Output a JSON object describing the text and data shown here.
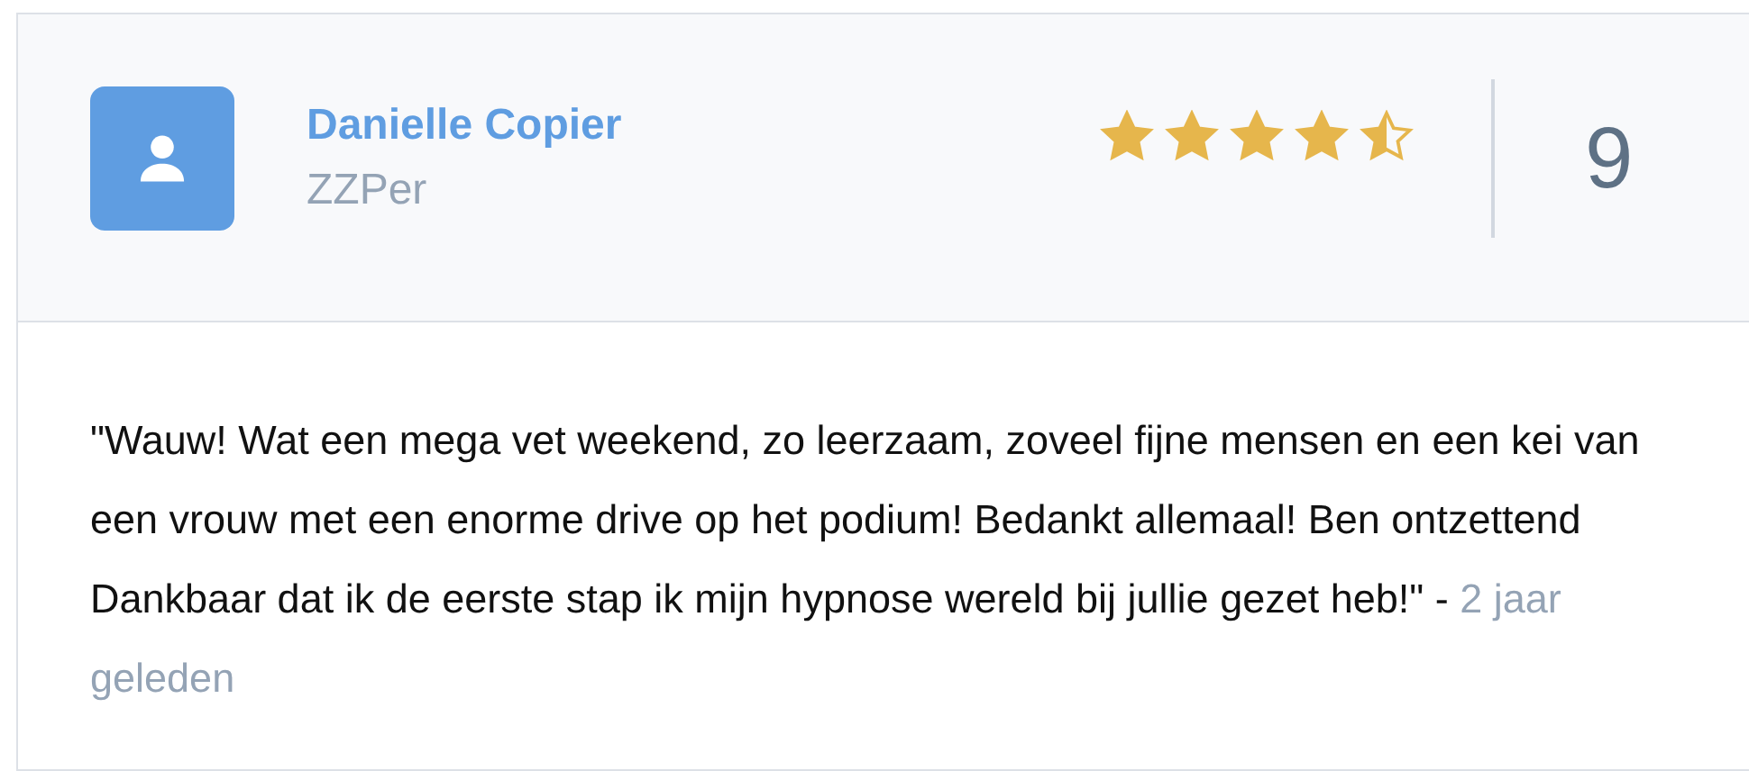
{
  "review": {
    "author": "Danielle Copier",
    "role": "ZZPer",
    "stars": 4.5,
    "score": "9",
    "text": "\"Wauw! Wat een mega vet weekend, zo leerzaam, zoveel fijne mensen en een kei van een vrouw met een enorme drive op het podium! Bedankt allemaal! Ben ontzettend Dankbaar dat ik de eerste stap ik mijn hypnose wereld bij jullie gezet heb!\" -",
    "time": "2 jaar geleden"
  }
}
